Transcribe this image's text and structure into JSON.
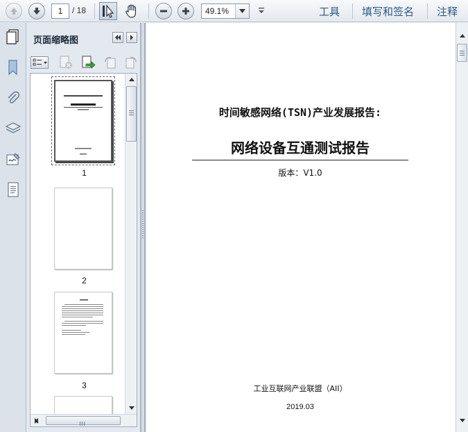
{
  "toolbar": {
    "page_current": "1",
    "page_total": "/ 18",
    "zoom": "49.1%",
    "links": [
      "工具",
      "填写和签名",
      "注释"
    ]
  },
  "sidebar": {
    "title": "页面缩略图",
    "thumbnails": [
      {
        "number": "1",
        "selected": true
      },
      {
        "number": "2",
        "selected": false
      },
      {
        "number": "3",
        "selected": false
      }
    ]
  },
  "document": {
    "line1": "时间敏感网络(TSN)产业发展报告:",
    "title": "网络设备互通测试报告",
    "version": "版本：V1.0",
    "organization": "工业互联网产业联盟（AII）",
    "date": "2019.03"
  },
  "colors": {
    "accent_link": "#2c5a8a",
    "toolbar_bg": "#e4e9ef"
  }
}
